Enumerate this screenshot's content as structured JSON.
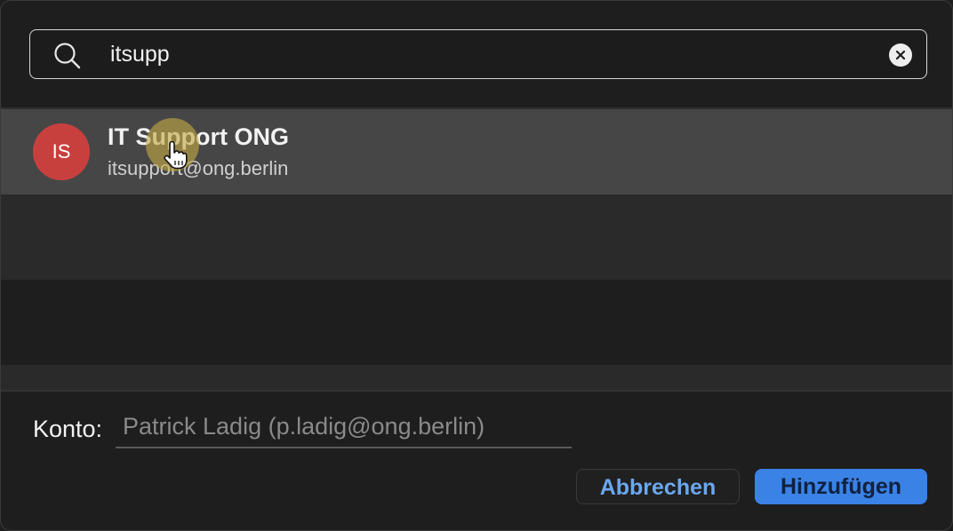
{
  "search": {
    "value": "itsupp",
    "icon": "search-icon",
    "clear_icon": "clear-icon"
  },
  "results": [
    {
      "initials": "IS",
      "name": "IT Support ONG",
      "email": "itsupport@ong.berlin",
      "avatar_color": "#c8403e"
    }
  ],
  "account": {
    "label": "Konto:",
    "value": "Patrick Ladig (p.ladig@ong.berlin)"
  },
  "buttons": {
    "cancel": "Abbrechen",
    "add": "Hinzufügen"
  },
  "colors": {
    "accent": "#3a82e6",
    "selected_row": "#464646"
  }
}
